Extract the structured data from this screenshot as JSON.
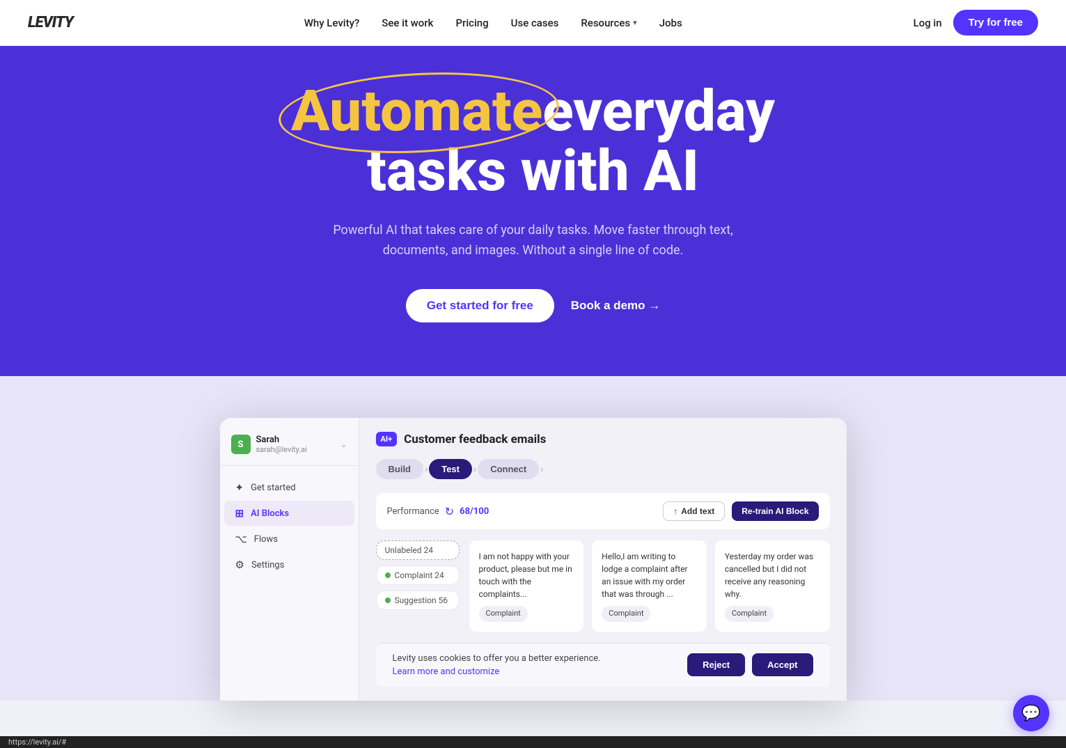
{
  "nav": {
    "logo": "LEVITY",
    "links": [
      {
        "label": "Why Levity?",
        "id": "why-levity"
      },
      {
        "label": "See it work",
        "id": "see-it-work"
      },
      {
        "label": "Pricing",
        "id": "pricing"
      },
      {
        "label": "Use cases",
        "id": "use-cases"
      },
      {
        "label": "Resources",
        "id": "resources",
        "hasDropdown": true
      },
      {
        "label": "Jobs",
        "id": "jobs"
      }
    ],
    "login_label": "Log in",
    "try_label": "Try for free"
  },
  "hero": {
    "headline_pre": "",
    "headline_highlight": "Automate",
    "headline_rest": "everyday tasks with AI",
    "subtext": "Powerful AI that takes care of your daily tasks. Move faster through text, documents, and images. Without a single line of code.",
    "cta_primary": "Get started for free",
    "cta_demo": "Book a demo →"
  },
  "app": {
    "sidebar": {
      "user": {
        "name": "Sarah",
        "email": "sarah@levity.ai",
        "avatar_letter": "S"
      },
      "items": [
        {
          "label": "Get started",
          "icon": "✦",
          "id": "get-started",
          "active": false
        },
        {
          "label": "AI Blocks",
          "icon": "⊞",
          "id": "ai-blocks",
          "active": true
        },
        {
          "label": "Flows",
          "icon": "⌥",
          "id": "flows",
          "active": false
        },
        {
          "label": "Settings",
          "icon": "⚙",
          "id": "settings",
          "active": false
        }
      ]
    },
    "main": {
      "badge": "AI+",
      "title": "Customer feedback emails",
      "tabs": [
        {
          "label": "Build",
          "state": "grey"
        },
        {
          "label": "Test",
          "state": "active"
        },
        {
          "label": "Connect",
          "state": "grey"
        }
      ],
      "performance": {
        "label": "Performance",
        "score": "68/100",
        "add_text_btn": "Add text",
        "retrain_btn": "Re-train AI Block"
      },
      "labels": [
        {
          "text": "Unlabeled",
          "count": 24,
          "type": "outline"
        },
        {
          "text": "Complaint",
          "count": 24,
          "type": "dot-green"
        },
        {
          "text": "Suggestion",
          "count": 56,
          "type": "dot-green"
        }
      ],
      "cards": [
        {
          "text": "I am not happy with your product, please but me in touch with the complaints...",
          "badge": "Complaint"
        },
        {
          "text": "Hello,I am writing to lodge a complaint after an issue with my order that was through ...",
          "badge": "Complaint"
        },
        {
          "text": "Yesterday my order was cancelled but I did not receive any reasoning why.",
          "badge": "Complaint"
        }
      ]
    },
    "cookie": {
      "message": "Levity uses cookies to offer you a better experience.",
      "link_text": "Learn more and customize",
      "reject_btn": "Reject",
      "accept_btn": "Accept"
    }
  },
  "status_bar": {
    "url": "https://levity.ai/#"
  },
  "chat": {
    "icon": "💬"
  }
}
